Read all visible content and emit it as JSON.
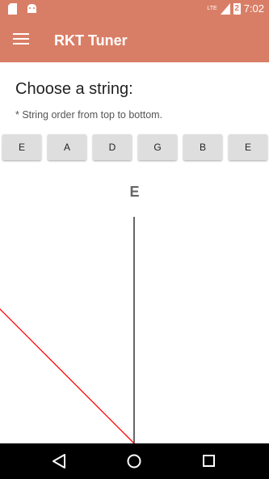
{
  "status_bar": {
    "time": "7:02",
    "network": "LTE",
    "battery": "2",
    "icons": [
      "sd-card-icon",
      "android-icon",
      "lte-signal-icon",
      "battery-icon"
    ]
  },
  "app_bar": {
    "title": "RKT Tuner",
    "menu_icon": "hamburger-menu-icon"
  },
  "main": {
    "heading": "Choose a string:",
    "note": "* String order from top to bottom.",
    "strings": [
      "E",
      "A",
      "D",
      "G",
      "B",
      "E"
    ],
    "selected_note": "E"
  },
  "meter": {
    "needle_color": "#ff0000",
    "center_line_color": "#000000",
    "needle_angle_deg": -45
  },
  "nav": {
    "icons": [
      "back-icon",
      "home-icon",
      "recents-icon"
    ]
  },
  "colors": {
    "accent": "#d97e66"
  }
}
